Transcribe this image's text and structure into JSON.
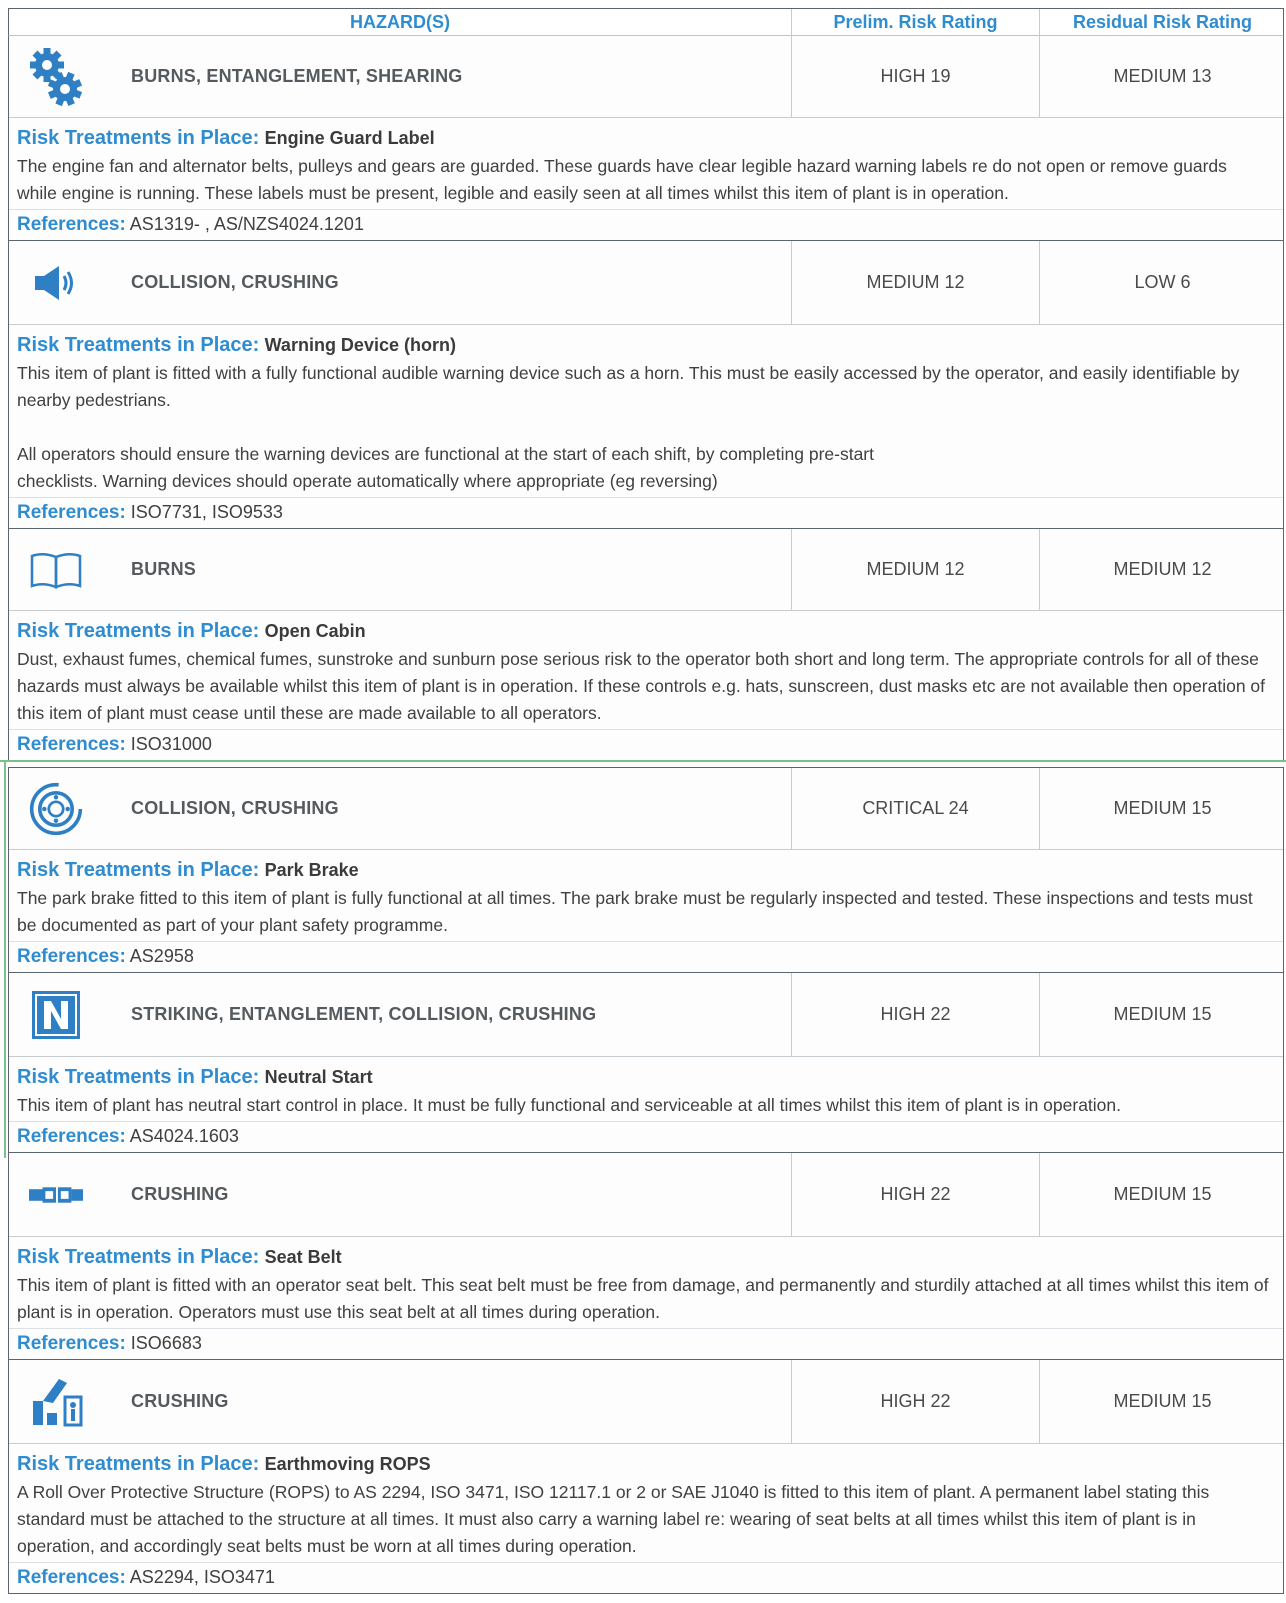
{
  "header": {
    "hazards": "HAZARD(S)",
    "prelim": "Prelim. Risk Rating",
    "residual": "Residual Risk Rating"
  },
  "labels": {
    "treatments": "Risk Treatments in Place:",
    "references": "References:"
  },
  "rows": [
    {
      "icon": "gears-icon",
      "hazard": "BURNS, ENTANGLEMENT, SHEARING",
      "prelim": "HIGH 19",
      "residual": "MEDIUM 13",
      "treatment": "Engine Guard Label",
      "desc1": "The engine fan and alternator belts, pulleys and gears are guarded. These guards have clear legible hazard warning labels re do not open or remove guards while engine is running. These labels must be present, legible and easily seen at all times whilst this item of plant is in operation.",
      "desc2": "",
      "refs": "AS1319- , AS/NZS4024.1201"
    },
    {
      "icon": "speaker-icon",
      "hazard": "COLLISION, CRUSHING",
      "prelim": "MEDIUM 12",
      "residual": "LOW 6",
      "treatment": "Warning Device (horn)",
      "desc1": "This item of plant is fitted with a fully functional audible warning device such as a horn. This must be easily accessed by the operator, and easily identifiable by nearby pedestrians.",
      "desc2": "All operators should ensure the warning devices are functional at the start of each shift, by completing pre-start checklists. Warning devices should operate automatically where appropriate (eg reversing)",
      "refs": "ISO7731, ISO9533"
    },
    {
      "icon": "book-icon",
      "hazard": "BURNS",
      "prelim": "MEDIUM 12",
      "residual": "MEDIUM 12",
      "treatment": "Open Cabin",
      "desc1": "Dust, exhaust fumes, chemical fumes, sunstroke and sunburn pose serious risk to the operator both short and long term. The appropriate controls for all of these hazards must always be available whilst this item of plant is in operation. If these controls e.g. hats, sunscreen, dust masks etc are not available then operation of this item of plant must cease until these are made available to all operators.",
      "desc2": "",
      "refs": "ISO31000"
    },
    {
      "icon": "brake-disc-icon",
      "hazard": "COLLISION, CRUSHING",
      "prelim": "CRITICAL 24",
      "residual": "MEDIUM 15",
      "treatment": "Park Brake",
      "desc1": "The park brake fitted to this item of plant is fully functional at all times. The park brake must be regularly inspected and tested. These inspections and tests must be documented as part of your plant safety programme.",
      "desc2": "",
      "refs": "AS2958"
    },
    {
      "icon": "neutral-n-icon",
      "hazard": "STRIKING, ENTANGLEMENT, COLLISION, CRUSHING",
      "prelim": "HIGH 22",
      "residual": "MEDIUM 15",
      "treatment": "Neutral Start",
      "desc1": "This item of plant has neutral start control in place. It must be fully functional and serviceable at all times whilst this item of plant is in operation.",
      "desc2": "",
      "refs": "AS4024.1603"
    },
    {
      "icon": "seat-belt-icon",
      "hazard": "CRUSHING",
      "prelim": "HIGH 22",
      "residual": "MEDIUM 15",
      "treatment": "Seat Belt",
      "desc1": "This item of plant is fitted with an operator seat belt. This seat belt must be free from damage, and permanently and sturdily attached at all times whilst this item of plant is in operation. Operators must use this seat belt at all times during operation.",
      "desc2": "",
      "refs": "ISO6683"
    },
    {
      "icon": "rops-icon",
      "hazard": "CRUSHING",
      "prelim": "HIGH 22",
      "residual": "MEDIUM 15",
      "treatment": "Earthmoving ROPS",
      "desc1": "A Roll Over Protective Structure (ROPS) to AS 2294, ISO 3471, ISO 12117.1 or 2 or SAE J1040 is fitted to this item of plant. A permanent label stating this standard must be attached to the structure at all times. It must also carry a warning label re: wearing of seat belts at all times whilst this item of plant is in operation, and accordingly seat belts must be worn at all times during operation.",
      "desc2": "",
      "refs": "AS2294, ISO3471"
    }
  ]
}
